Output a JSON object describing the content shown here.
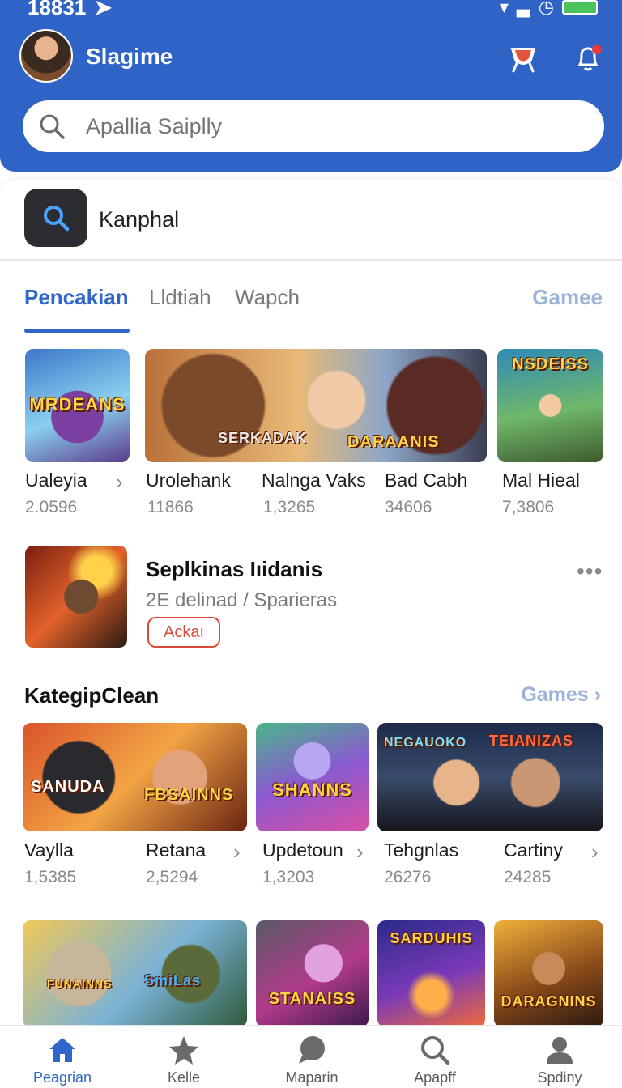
{
  "status_bar": {
    "time": "18831"
  },
  "header": {
    "title": "Slagime",
    "search_placeholder": "Apallia Saiplly"
  },
  "top_card": {
    "label": "Kanphal"
  },
  "tabs": {
    "items": [
      {
        "label": "Pencakian",
        "active": true
      },
      {
        "label": "Lldtiah",
        "active": false
      },
      {
        "label": "Wapch",
        "active": false
      }
    ],
    "right_label": "Gamee"
  },
  "row1": [
    {
      "name": "Ualeyia",
      "count": "2.0596",
      "logo": "MRDEANS"
    },
    {
      "name": "Urolehank",
      "count": "11866",
      "logo": "SERKADAK"
    },
    {
      "name": "Nalnga Vaks",
      "count": "1,3265",
      "logo": "DARAANIS"
    },
    {
      "name": "Bad Cabh",
      "count": "34606",
      "logo": ""
    },
    {
      "name": "Mal Hieal",
      "count": "7,3806",
      "logo": "NSDEISS"
    }
  ],
  "featured": {
    "title": "Seplkinas Iıidanis",
    "subtitle": "2E delinad / Sparieras",
    "button": "Ackaı"
  },
  "section": {
    "title": "KategipClean",
    "link": "Games"
  },
  "row2": [
    {
      "name": "Vaylla",
      "count": "1,5385",
      "logo": "SANUDA"
    },
    {
      "name": "Retana",
      "count": "2,5294",
      "logo": "FBSAINNS"
    },
    {
      "name": "Updetoun",
      "count": "1,3203",
      "logo": "SHANNS"
    },
    {
      "name": "Tehgnlas",
      "count": "26276",
      "logo": "NEGAUOKO"
    },
    {
      "name": "Cartiny",
      "count": "24285",
      "logo": "TEIANIZAS"
    }
  ],
  "row3_logos": [
    "FUNAINNS",
    "SmiLas",
    "STANAISS",
    "SARDUHIS",
    "DARAGNINS"
  ],
  "bottom_nav": [
    {
      "label": "Peagrian",
      "icon": "home-icon",
      "active": true
    },
    {
      "label": "Kelle",
      "icon": "star-icon",
      "active": false
    },
    {
      "label": "Maparin",
      "icon": "chat-icon",
      "active": false
    },
    {
      "label": "Apapff",
      "icon": "search-icon",
      "active": false
    },
    {
      "label": "Spdiny",
      "icon": "profile-icon",
      "active": false
    }
  ],
  "colors": {
    "brand": "#2f63c6",
    "accent": "#2f66c8",
    "danger": "#d94a3a"
  }
}
